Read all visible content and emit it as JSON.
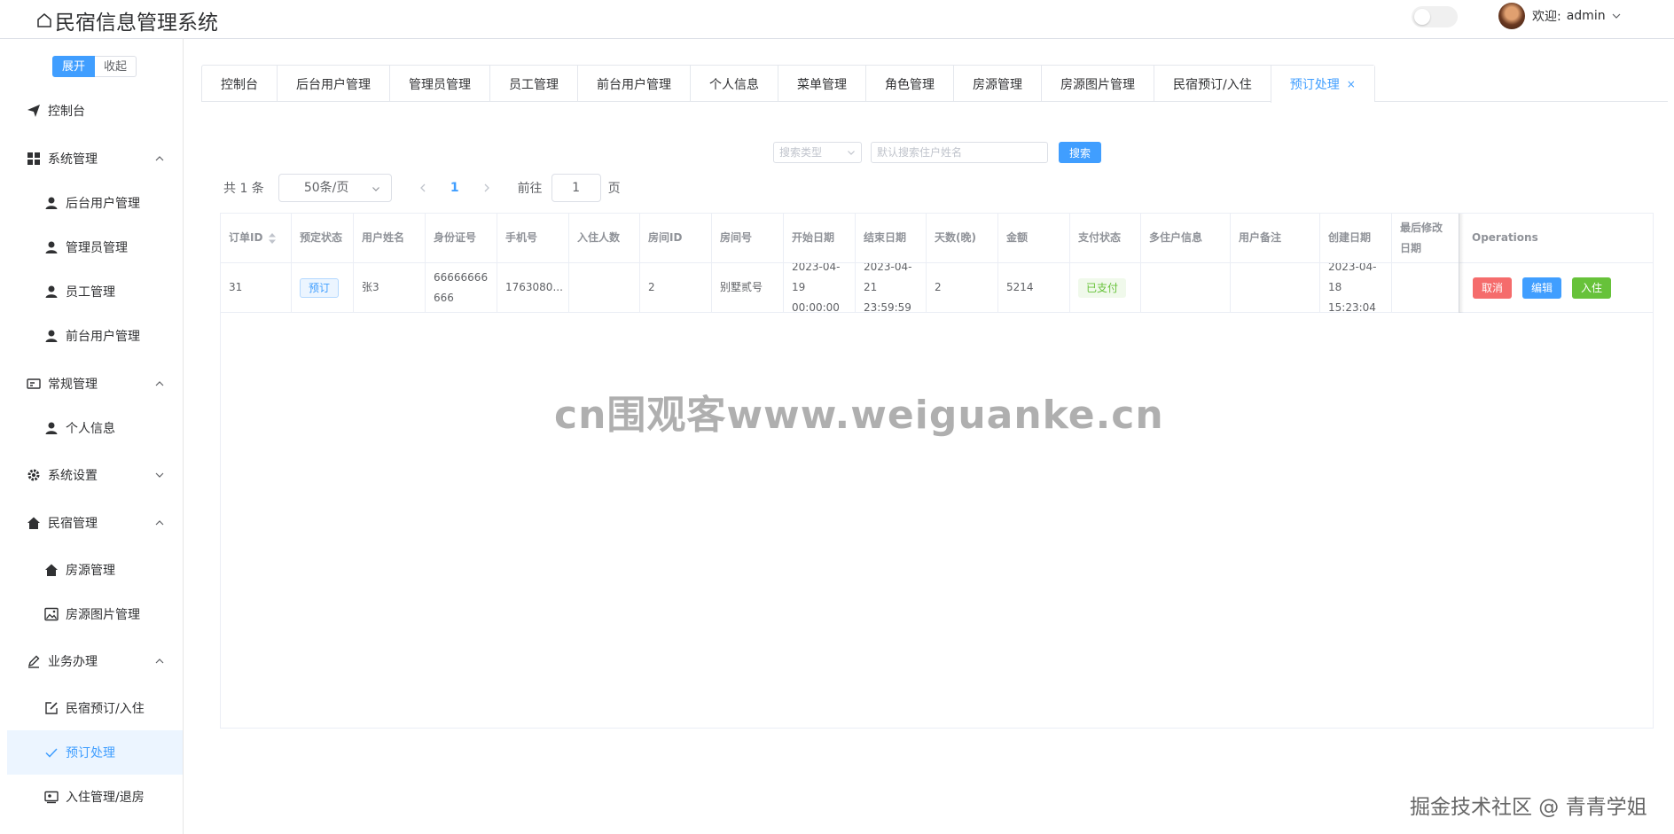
{
  "header": {
    "title": "民宿信息管理系统",
    "welcome_prefix": "欢迎:",
    "username": "admin"
  },
  "sidebar": {
    "expand_label": "展开",
    "collapse_label": "收起",
    "items": [
      {
        "label": "控制台",
        "icon": "send-icon",
        "level": 1
      },
      {
        "label": "系统管理",
        "icon": "grid-icon",
        "level": 1,
        "arrow": "up"
      },
      {
        "label": "后台用户管理",
        "icon": "user-icon",
        "level": 2
      },
      {
        "label": "管理员管理",
        "icon": "user-icon",
        "level": 2
      },
      {
        "label": "员工管理",
        "icon": "user-icon",
        "level": 2
      },
      {
        "label": "前台用户管理",
        "icon": "user-icon",
        "level": 2
      },
      {
        "label": "常规管理",
        "icon": "card-icon",
        "level": 1,
        "arrow": "up"
      },
      {
        "label": "个人信息",
        "icon": "user-icon",
        "level": 2
      },
      {
        "label": "系统设置",
        "icon": "gear-icon",
        "level": 1,
        "arrow": "down"
      },
      {
        "label": "民宿管理",
        "icon": "home-icon",
        "level": 1,
        "arrow": "up"
      },
      {
        "label": "房源管理",
        "icon": "home-icon",
        "level": 2
      },
      {
        "label": "房源图片管理",
        "icon": "picture-icon",
        "level": 2
      },
      {
        "label": "业务办理",
        "icon": "pen-icon",
        "level": 1,
        "arrow": "up"
      },
      {
        "label": "民宿预订/入住",
        "icon": "edit-icon",
        "level": 2
      },
      {
        "label": "预订处理",
        "icon": "check-icon",
        "level": 2,
        "active": true
      },
      {
        "label": "入住管理/退房",
        "icon": "id-card-icon",
        "level": 2
      }
    ]
  },
  "tabs": [
    {
      "label": "控制台"
    },
    {
      "label": "后台用户管理"
    },
    {
      "label": "管理员管理"
    },
    {
      "label": "员工管理"
    },
    {
      "label": "前台用户管理"
    },
    {
      "label": "个人信息"
    },
    {
      "label": "菜单管理"
    },
    {
      "label": "角色管理"
    },
    {
      "label": "房源管理"
    },
    {
      "label": "房源图片管理"
    },
    {
      "label": "民宿预订/入住"
    },
    {
      "label": "预订处理",
      "active": true,
      "close": "×"
    }
  ],
  "search": {
    "type_placeholder": "搜索类型",
    "input_placeholder": "默认搜索住户姓名",
    "button_label": "搜索"
  },
  "pagination": {
    "total": "共 1 条",
    "page_size": "50条/页",
    "current_page": "1",
    "goto_label": "前往",
    "goto_value": "1",
    "goto_unit": "页"
  },
  "table": {
    "headers": [
      "订单ID",
      "预定状态",
      "用户姓名",
      "身份证号",
      "手机号",
      "入住人数",
      "房间ID",
      "房间号",
      "开始日期",
      "结束日期",
      "天数(晚)",
      "金额",
      "支付状态",
      "多住户信息",
      "用户备注",
      "创建日期",
      "最后修改日期",
      "Operations"
    ],
    "row": {
      "order_id": "31",
      "status": "预订",
      "user_name": "张3",
      "id_number": "66666666666",
      "phone": "1763080...",
      "guests": "",
      "room_id": "2",
      "room_no": "别墅贰号",
      "start_date": "2023-04-19 00:00:00",
      "end_date": "2023-04-21 23:59:59",
      "nights": "2",
      "amount": "5214",
      "pay_status": "已支付",
      "multi_guest": "",
      "remark": "",
      "created": "2023-04-18 15:23:04",
      "modified": ""
    },
    "ops": {
      "cancel": "取消",
      "edit": "编辑",
      "checkin": "入住"
    }
  },
  "watermark": "cn围观客www.weiguanke.cn",
  "corner_watermark": "掘金技术社区 @ 青青学姐",
  "colors": {
    "primary": "#409eff",
    "danger": "#f56c6c",
    "success": "#67c23a",
    "border": "#ebeef5"
  }
}
